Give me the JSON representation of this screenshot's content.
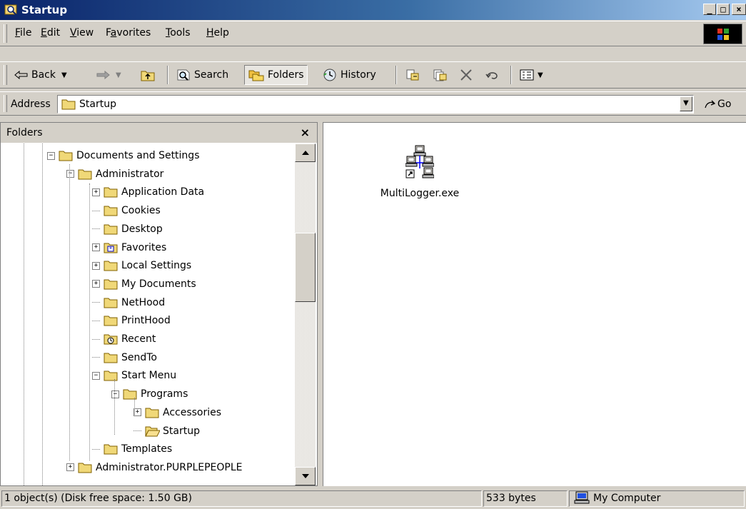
{
  "window": {
    "title": "Startup"
  },
  "menu": {
    "items": [
      {
        "label": "File",
        "accel": "F",
        "rest": "ile"
      },
      {
        "label": "Edit",
        "accel": "E",
        "rest": "dit"
      },
      {
        "label": "View",
        "accel": "V",
        "rest": "iew"
      },
      {
        "label": "Favorites",
        "pre": "F",
        "accel": "a",
        "rest": "vorites"
      },
      {
        "label": "Tools",
        "accel": "T",
        "rest": "ools"
      },
      {
        "label": "Help",
        "accel": "H",
        "rest": "elp"
      }
    ]
  },
  "toolbar": {
    "back_label": "Back",
    "search_label": "Search",
    "folders_label": "Folders",
    "history_label": "History"
  },
  "address": {
    "label": "Address",
    "value": "Startup",
    "go_label": "Go"
  },
  "folders_pane": {
    "title": "Folders",
    "close_glyph": "×",
    "tree": [
      {
        "label": "Documents and Settings",
        "level": 0,
        "expander": "−",
        "icon": "folder"
      },
      {
        "label": "Administrator",
        "level": 1,
        "expander": "−",
        "icon": "folder"
      },
      {
        "label": "Application Data",
        "level": 2,
        "expander": "+",
        "icon": "folder"
      },
      {
        "label": "Cookies",
        "level": 2,
        "expander": "",
        "icon": "folder"
      },
      {
        "label": "Desktop",
        "level": 2,
        "expander": "",
        "icon": "folder"
      },
      {
        "label": "Favorites",
        "level": 2,
        "expander": "+",
        "icon": "favorites-folder"
      },
      {
        "label": "Local Settings",
        "level": 2,
        "expander": "+",
        "icon": "folder"
      },
      {
        "label": "My Documents",
        "level": 2,
        "expander": "+",
        "icon": "folder"
      },
      {
        "label": "NetHood",
        "level": 2,
        "expander": "",
        "icon": "folder"
      },
      {
        "label": "PrintHood",
        "level": 2,
        "expander": "",
        "icon": "folder"
      },
      {
        "label": "Recent",
        "level": 2,
        "expander": "",
        "icon": "recent-folder"
      },
      {
        "label": "SendTo",
        "level": 2,
        "expander": "",
        "icon": "folder"
      },
      {
        "label": "Start Menu",
        "level": 2,
        "expander": "−",
        "icon": "folder"
      },
      {
        "label": "Programs",
        "level": 3,
        "expander": "−",
        "icon": "folder"
      },
      {
        "label": "Accessories",
        "level": 4,
        "expander": "+",
        "icon": "folder"
      },
      {
        "label": "Startup",
        "level": 4,
        "expander": "",
        "icon": "open-folder"
      },
      {
        "label": "Templates",
        "level": 2,
        "expander": "",
        "icon": "folder"
      },
      {
        "label": "Administrator.PURPLEPEOPLE",
        "level": 1,
        "expander": "+",
        "icon": "folder"
      }
    ]
  },
  "content": {
    "files": [
      {
        "name": "MultiLogger.exe",
        "icon": "network-computers-icon"
      }
    ]
  },
  "statusbar": {
    "objects": "1 object(s) (Disk free space: 1.50 GB)",
    "size": "533 bytes",
    "zone": "My Computer"
  }
}
